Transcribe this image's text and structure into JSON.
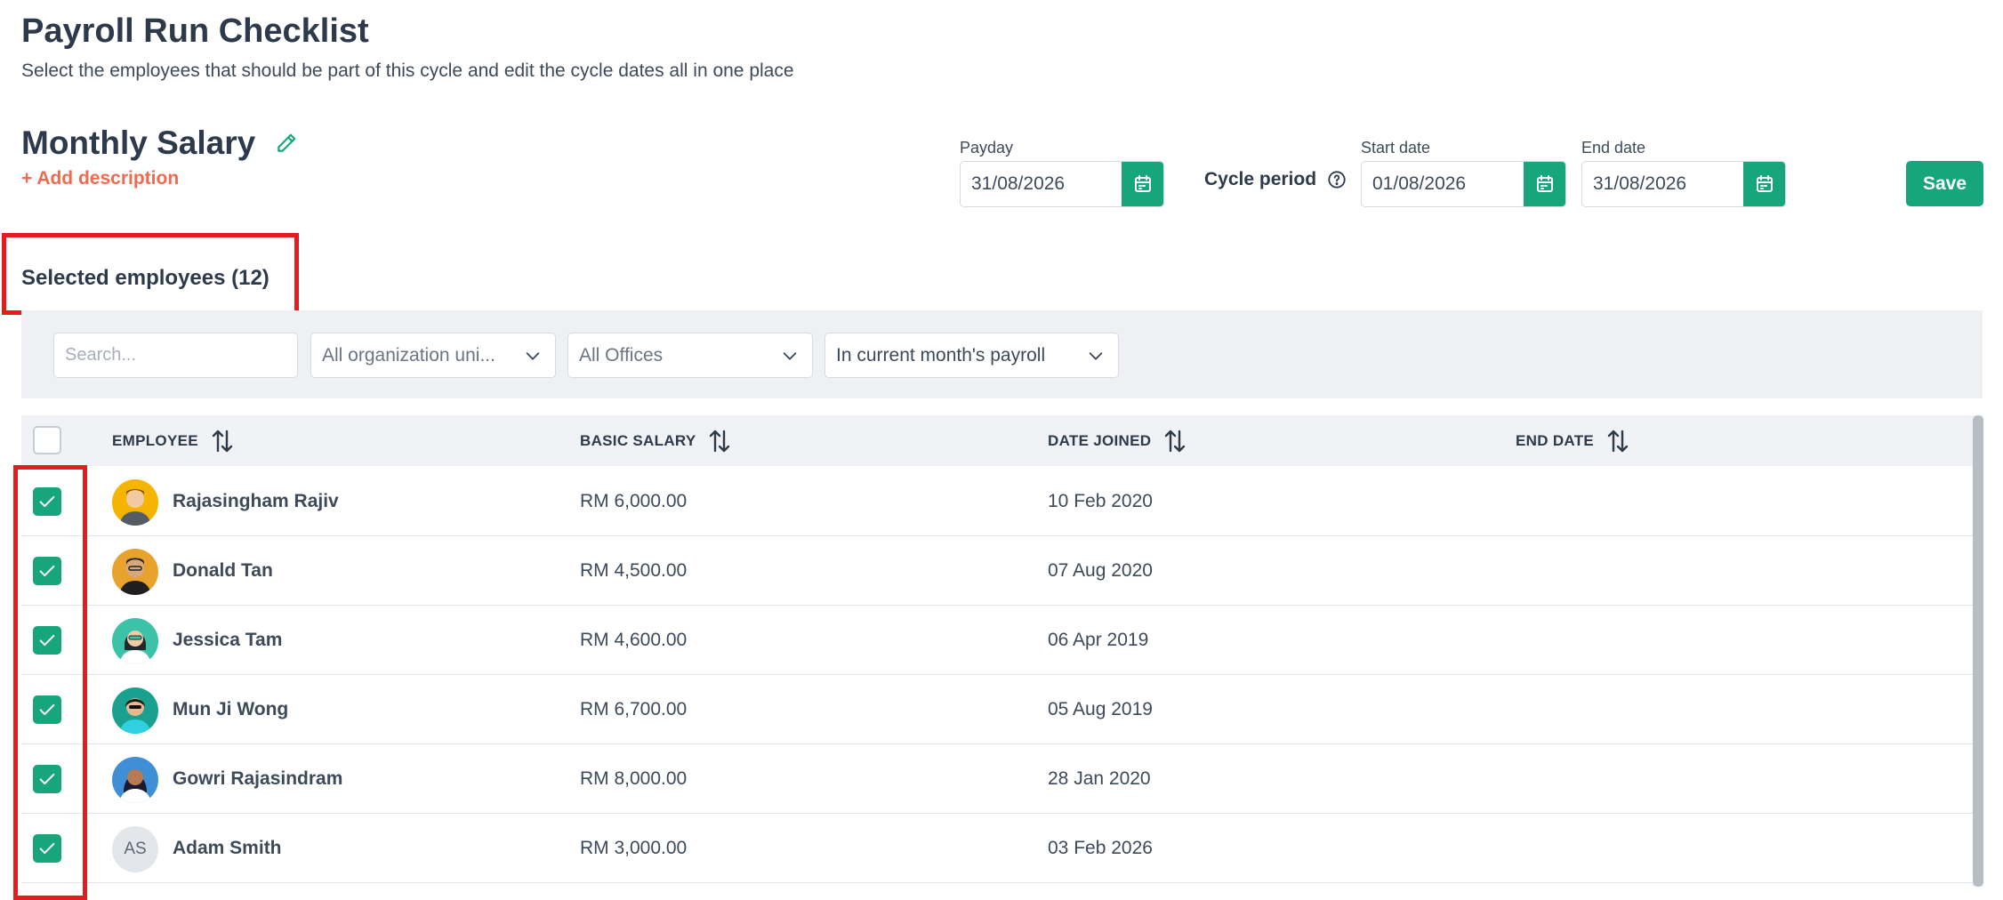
{
  "page": {
    "title": "Payroll Run Checklist",
    "subtitle": "Select the employees that should be part of this cycle and edit the cycle dates all in one place"
  },
  "cycle": {
    "name": "Monthly Salary",
    "add_description": "+ Add description",
    "payday_label": "Payday",
    "payday_value": "31/08/2026",
    "cycle_period_label": "Cycle period",
    "start_date_label": "Start date",
    "start_date_value": "01/08/2026",
    "end_date_label": "End date",
    "end_date_value": "31/08/2026",
    "save_label": "Save"
  },
  "employees_section": {
    "title": "Selected employees (12)"
  },
  "filters": {
    "search_placeholder": "Search...",
    "org_unit": "All organization uni...",
    "offices": "All Offices",
    "payroll_status": "In current month's payroll"
  },
  "table": {
    "columns": {
      "employee": "EMPLOYEE",
      "basic_salary": "BASIC SALARY",
      "date_joined": "DATE JOINED",
      "end_date": "END DATE"
    },
    "rows": [
      {
        "name": "Rajasingham Rajiv",
        "salary": "RM 6,000.00",
        "joined": "10 Feb 2020",
        "end": "",
        "avatar": "photo-avatar",
        "checked": true
      },
      {
        "name": "Donald Tan",
        "salary": "RM 4,500.00",
        "joined": "07 Aug 2020",
        "end": "",
        "avatar": "photo-avatar",
        "checked": true
      },
      {
        "name": "Jessica Tam",
        "salary": "RM 4,600.00",
        "joined": "06 Apr 2019",
        "end": "",
        "avatar": "photo-avatar",
        "checked": true
      },
      {
        "name": "Mun Ji Wong",
        "salary": "RM 6,700.00",
        "joined": "05 Aug 2019",
        "end": "",
        "avatar": "photo-avatar",
        "checked": true
      },
      {
        "name": "Gowri Rajasindram",
        "salary": "RM 8,000.00",
        "joined": "28 Jan 2020",
        "end": "",
        "avatar": "photo-avatar",
        "checked": true
      },
      {
        "name": "Adam Smith",
        "salary": "RM 3,000.00",
        "joined": "03 Feb 2026",
        "end": "",
        "avatar": "initials-avatar",
        "initials": "AS",
        "checked": true
      }
    ]
  },
  "colors": {
    "primary": "#17a57b",
    "accent": "#ef6a50",
    "highlight": "#e11d1d",
    "text": "#2c3a4b"
  },
  "icons": [
    "pencil-icon",
    "calendar-icon",
    "help-circle-icon",
    "chevron-down-icon",
    "sort-icon",
    "check-icon"
  ]
}
